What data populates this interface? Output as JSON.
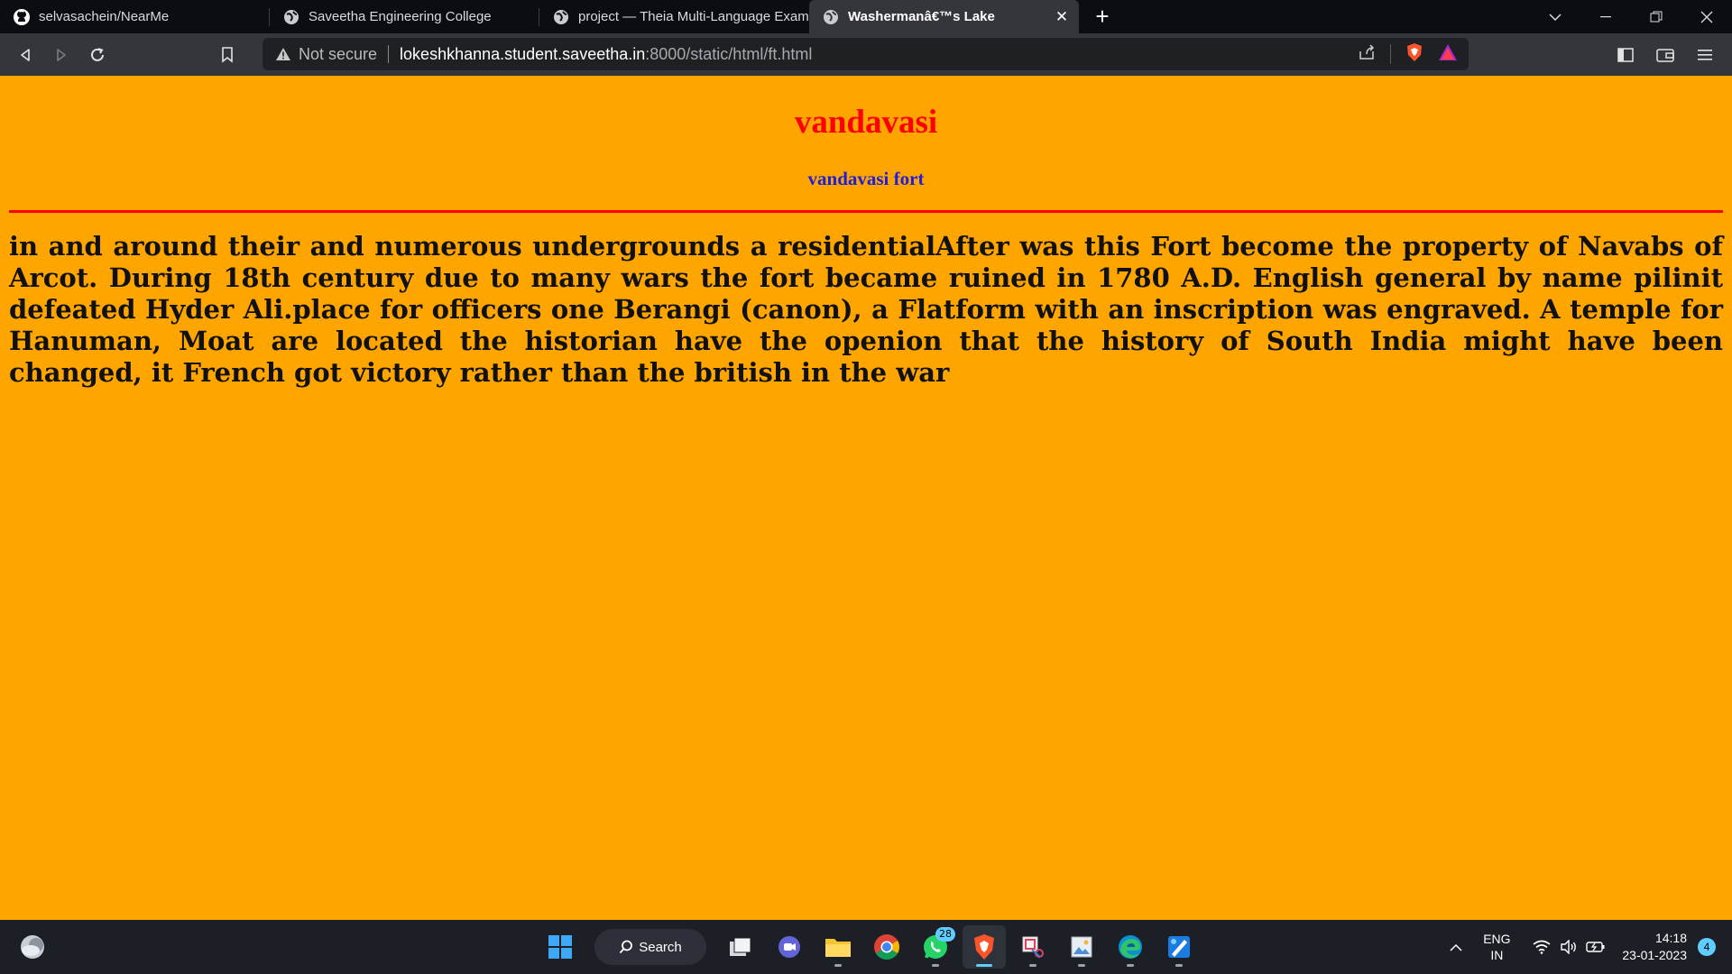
{
  "browser": {
    "tabs": [
      {
        "title": "selvasachein/NearMe",
        "icon": "github-icon",
        "active": false
      },
      {
        "title": "Saveetha Engineering College",
        "icon": "globe-icon",
        "active": false
      },
      {
        "title": "project — Theia Multi-Language Exam",
        "icon": "globe-icon",
        "active": false
      },
      {
        "title": "Washermanâ€™s Lake",
        "icon": "globe-icon",
        "active": true
      }
    ],
    "address": {
      "security_label": "Not secure",
      "host": "lokeshkhanna.student.saveetha.in",
      "path": ":8000/static/html/ft.html"
    }
  },
  "page": {
    "heading": "vandavasi",
    "subheading": "vandavasi fort",
    "body": "in and around their and numerous undergrounds a residentialAfter was this Fort become the property of Navabs of Arcot. During 18th century due to many wars the fort became ruined in 1780 A.D. English general by name pilinit defeated Hyder Ali.place for officers one Berangi (canon), a Flatform with an inscription was engraved. A temple for Hanuman, Moat are located the historian have the openion that the history of South India might have been changed, it French got victory rather than the british in the war",
    "colors": {
      "background": "#ffa500",
      "heading": "#ff0000",
      "subheading": "#1f1fd8",
      "rule": "#ff0000"
    }
  },
  "taskbar": {
    "search_label": "Search",
    "whatsapp_badge": "28",
    "lang_line1": "ENG",
    "lang_line2": "IN",
    "time": "14:18",
    "date": "23-01-2023",
    "notification_count": "4"
  }
}
